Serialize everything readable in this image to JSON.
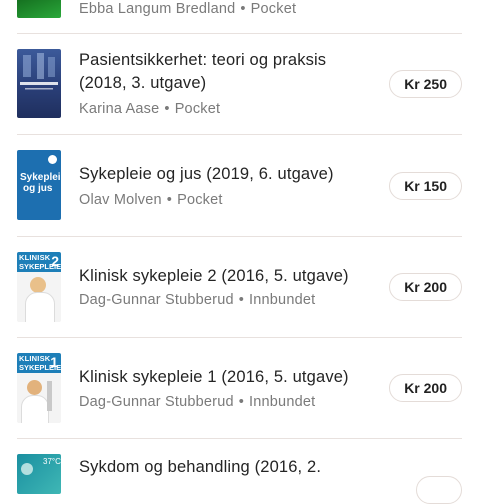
{
  "listings": [
    {
      "title": "",
      "author": "Ebba Langum Bredland",
      "format": "Pocket",
      "price": "",
      "cover": {
        "icon": "book-cover-green",
        "bg": "#1f8a2a"
      }
    },
    {
      "title": "Pasientsikkerhet: teori og praksis (2018, 3. utgave)",
      "author": "Karina Aase",
      "format": "Pocket",
      "price": "Kr 250",
      "cover": {
        "icon": "book-cover-pasientsikkerhet",
        "bg": "#2b3f7c"
      }
    },
    {
      "title": "Sykepleie og jus (2019, 6. utgave)",
      "author": "Olav Molven",
      "format": "Pocket",
      "price": "Kr 150",
      "cover": {
        "icon": "book-cover-sykepleie-og-jus",
        "bg": "#1d6fb0",
        "label_line1": "Sykepleie",
        "label_line2": "og jus"
      }
    },
    {
      "title": "Klinisk sykepleie 2 (2016, 5. utgave)",
      "author": "Dag-Gunnar Stubberud",
      "format": "Innbundet",
      "price": "Kr 200",
      "cover": {
        "icon": "book-cover-klinisk-sykepleie-2",
        "bg": "#1e7fb8",
        "label_line1": "KLINISK",
        "label_line2": "SYKEPLEIE",
        "number": "2"
      }
    },
    {
      "title": "Klinisk sykepleie 1 (2016, 5. utgave)",
      "author": "Dag-Gunnar Stubberud",
      "format": "Innbundet",
      "price": "Kr 200",
      "cover": {
        "icon": "book-cover-klinisk-sykepleie-1",
        "bg": "#1e7fb8",
        "label_line1": "KLINISK",
        "label_line2": "SYKEPLEIE",
        "number": "1"
      }
    },
    {
      "title": "Sykdom og behandling (2016, 2.",
      "author": "",
      "format": "",
      "price": "",
      "cover": {
        "icon": "book-cover-sykdom-og-behandling",
        "bg": "#1a8fa0",
        "label_line1": "37°C"
      }
    }
  ],
  "colors": {
    "divider": "#e8e1de",
    "meta": "#7a7a7a",
    "price_border": "#e4dcd8"
  }
}
